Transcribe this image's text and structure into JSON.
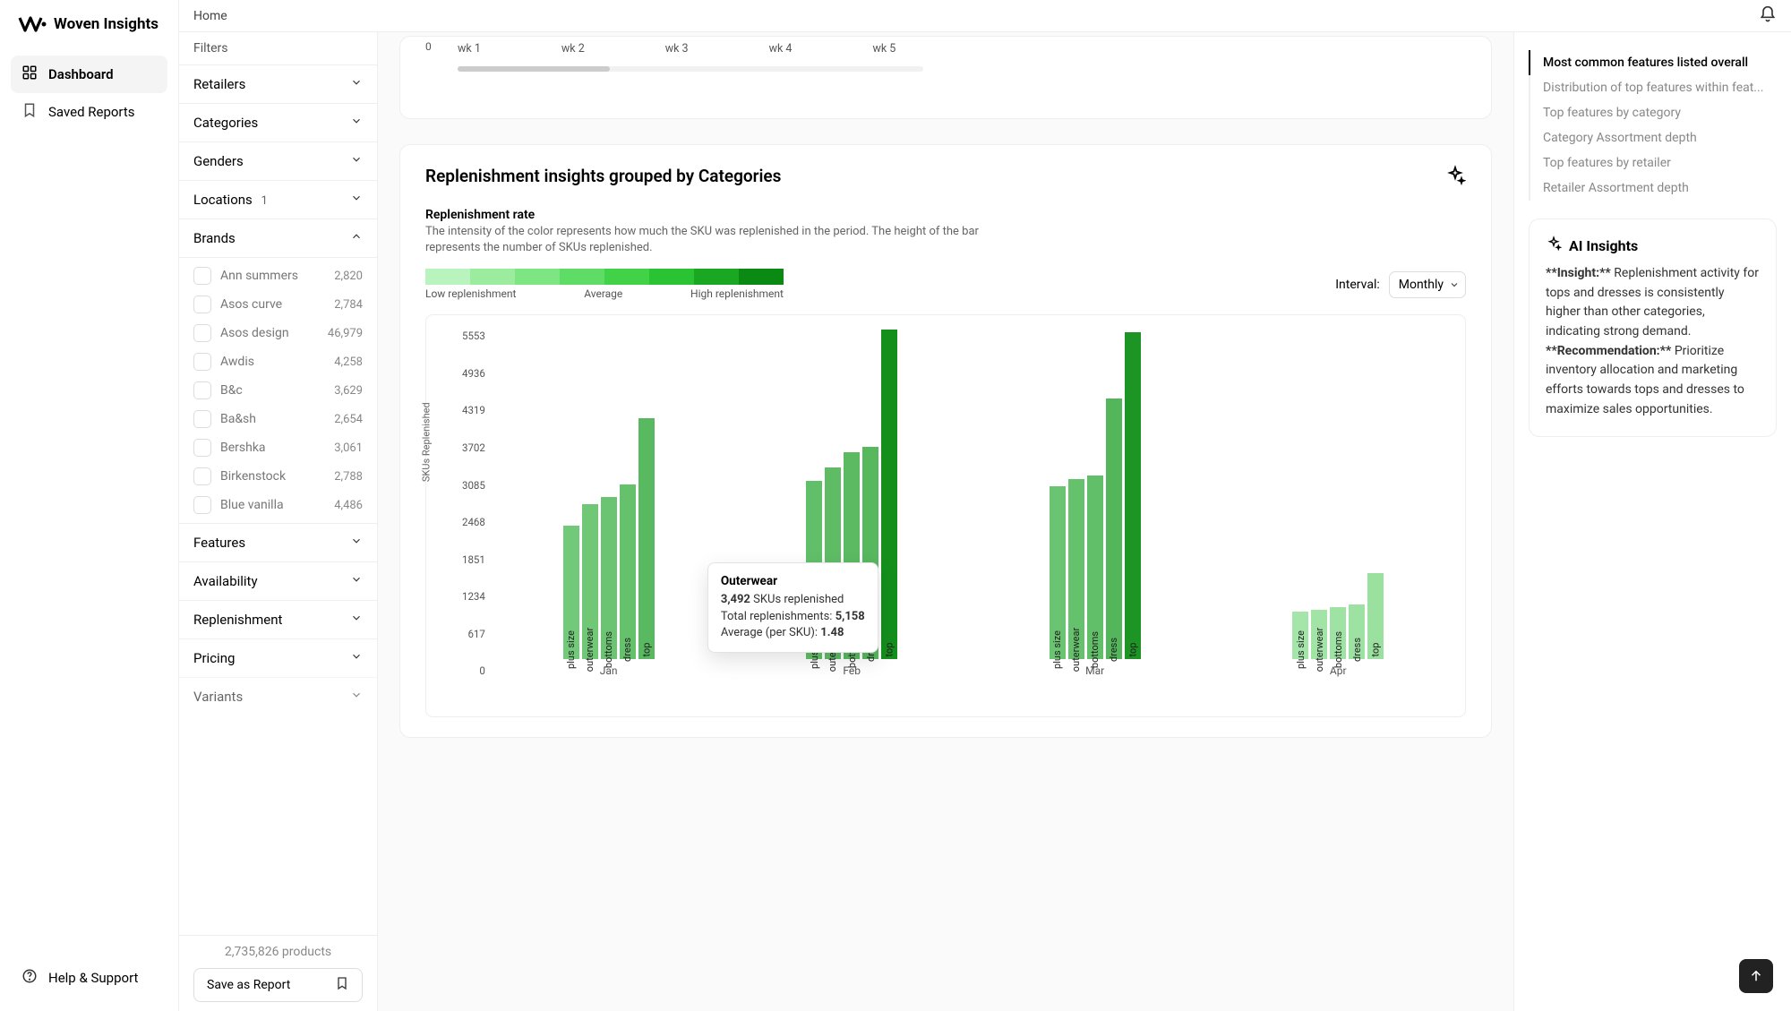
{
  "app_name": "Woven Insights",
  "topbar": {
    "home": "Home"
  },
  "nav": {
    "dashboard": "Dashboard",
    "saved_reports": "Saved Reports",
    "help": "Help & Support"
  },
  "filters": {
    "title": "Filters",
    "sections": {
      "retailers": "Retailers",
      "categories": "Categories",
      "genders": "Genders",
      "locations": "Locations",
      "locations_badge": "1",
      "brands": "Brands",
      "features": "Features",
      "availability": "Availability",
      "replenishment": "Replenishment",
      "pricing": "Pricing",
      "variants": "Variants"
    },
    "brands": [
      {
        "name": "Ann summers",
        "count": "2,820"
      },
      {
        "name": "Asos curve",
        "count": "2,784"
      },
      {
        "name": "Asos design",
        "count": "46,979"
      },
      {
        "name": "Awdis",
        "count": "4,258"
      },
      {
        "name": "B&c",
        "count": "3,629"
      },
      {
        "name": "Ba&sh",
        "count": "2,654"
      },
      {
        "name": "Bershka",
        "count": "3,061"
      },
      {
        "name": "Birkenstock",
        "count": "2,788"
      },
      {
        "name": "Blue vanilla",
        "count": "4,486"
      }
    ],
    "product_count": "2,735,826 products",
    "save_report": "Save as Report"
  },
  "mini_chart": {
    "zero": "0",
    "ticks": [
      "wk 1",
      "wk 2",
      "wk 3",
      "wk 4",
      "wk 5"
    ]
  },
  "card": {
    "title": "Replenishment insights grouped by Categories",
    "rate_title": "Replenishment rate",
    "rate_desc": "The intensity of the color represents how much the SKU was replenished in the period. The height of the bar represents the number of SKUs replenished.",
    "grad_low": "Low replenishment",
    "grad_avg": "Average",
    "grad_high": "High replenishment",
    "interval_label": "Interval:",
    "interval_value": "Monthly"
  },
  "chart_data": {
    "type": "bar",
    "ylabel": "SKUs Replenished",
    "ylim": [
      0,
      5553
    ],
    "y_ticks": [
      "5553",
      "4936",
      "4319",
      "3702",
      "3085",
      "2468",
      "1851",
      "1234",
      "617",
      "0"
    ],
    "months": [
      "Jan",
      "Feb",
      "Mar",
      "Apr"
    ],
    "categories": [
      "plus size",
      "outerwear",
      "bottoms",
      "dress",
      "top"
    ],
    "series": [
      {
        "month": "Jan",
        "values": [
          2250,
          2620,
          2740,
          2950,
          4070
        ],
        "intensity": [
          0.4,
          0.42,
          0.45,
          0.48,
          0.55
        ]
      },
      {
        "month": "Feb",
        "values": [
          3010,
          3230,
          3492,
          3580,
          5553
        ],
        "intensity": [
          0.5,
          0.52,
          0.54,
          0.56,
          0.95
        ]
      },
      {
        "month": "Mar",
        "values": [
          2920,
          3040,
          3100,
          4400,
          5520
        ],
        "intensity": [
          0.45,
          0.48,
          0.5,
          0.58,
          0.9
        ]
      },
      {
        "month": "Apr",
        "values": [
          810,
          840,
          880,
          920,
          1450
        ],
        "intensity": [
          0.12,
          0.14,
          0.15,
          0.16,
          0.18
        ]
      }
    ],
    "tooltip": {
      "category": "Outerwear",
      "skus": "3,492",
      "skus_suffix": "SKUs replenished",
      "total_label": "Total replenishments:",
      "total": "5,158",
      "avg_label": "Average (per SKU):",
      "avg": "1.48"
    }
  },
  "toc": [
    "Most common features listed overall",
    "Distribution of top features within feat...",
    "Top features by category",
    "Category Assortment depth",
    "Top features by retailer",
    "Retailer Assortment depth"
  ],
  "ai": {
    "title": "AI Insights",
    "insight_label": "**Insight:**",
    "insight": "Replenishment activity for tops and dresses is consistently higher than other categories, indicating strong demand.",
    "rec_label": "**Recommendation:**",
    "rec": "Prioritize inventory allocation and marketing efforts towards tops and dresses to maximize sales opportunities."
  },
  "gradient_colors": [
    "#b9f3be",
    "#9bec9f",
    "#7de582",
    "#5fdc65",
    "#41d248",
    "#2ac333",
    "#1aa823",
    "#0b8a13"
  ]
}
